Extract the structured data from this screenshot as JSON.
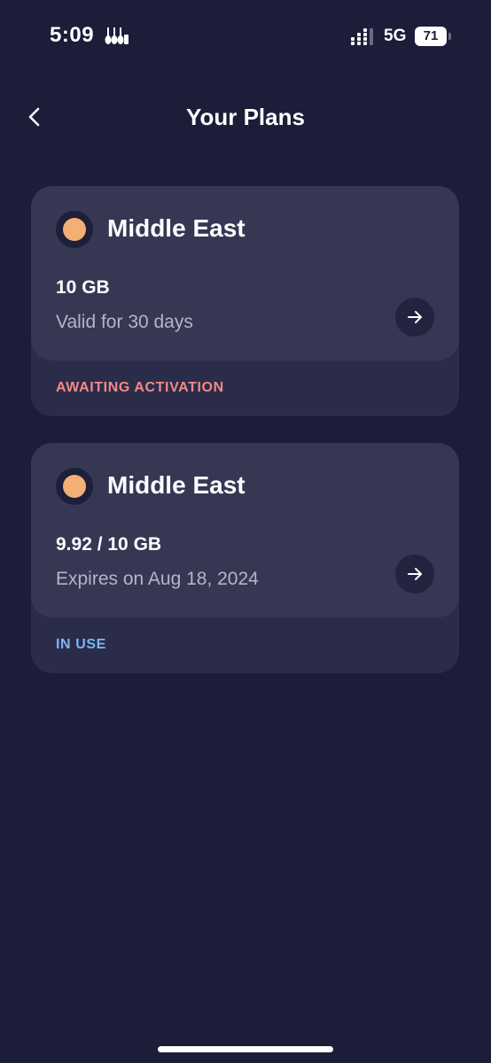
{
  "status_bar": {
    "time": "5:09",
    "network": "5G",
    "battery": "71",
    "app_icon": "guitars-icon",
    "signal_icon": "signal-bars-icon"
  },
  "header": {
    "title": "Your Plans",
    "back_icon": "chevron-left-icon"
  },
  "plans": [
    {
      "region": "Middle East",
      "data": "10 GB",
      "detail": "Valid for 30 days",
      "status": "AWAITING ACTIVATION",
      "status_color": "#f28a86",
      "icon_color": "#f3b074"
    },
    {
      "region": "Middle East",
      "data": "9.92 / 10 GB",
      "detail": "Expires on Aug 18, 2024",
      "status": "IN USE",
      "status_color": "#7cb6f5",
      "icon_color": "#f3b074"
    }
  ],
  "colors": {
    "background": "#1c1d38",
    "card_outer": "#2b2c4a",
    "card_inner": "#363753",
    "arrow_button_bg": "#22233f"
  }
}
